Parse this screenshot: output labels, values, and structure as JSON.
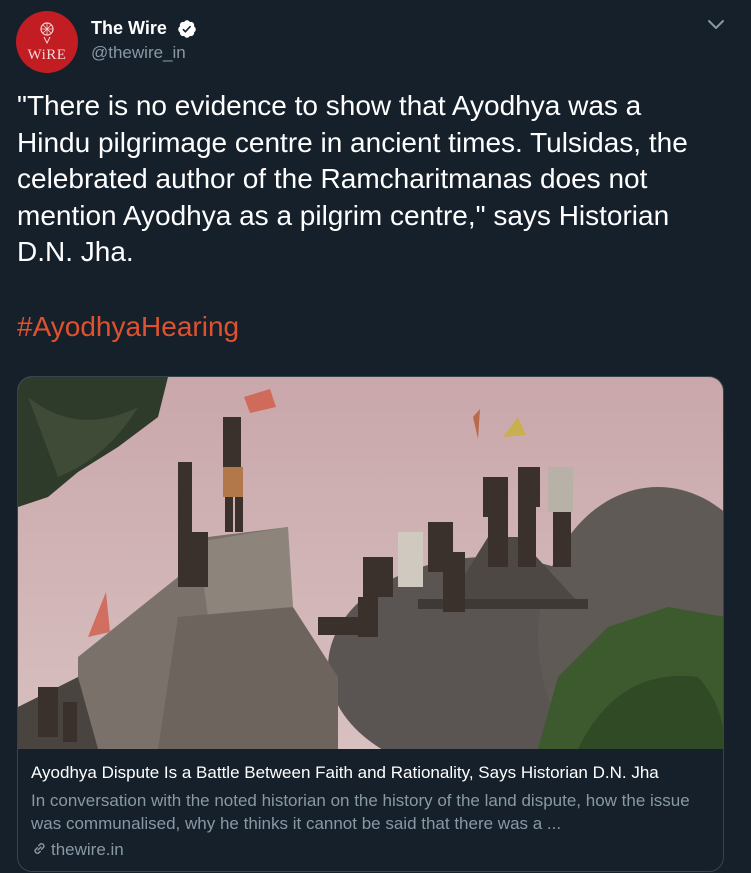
{
  "author": {
    "name": "The Wire",
    "handle": "@thewire_in",
    "avatar_text": "WiRE",
    "verified": true
  },
  "icons": {
    "verified": "verified-badge-icon",
    "menu": "chevron-down-icon",
    "link": "link-icon"
  },
  "tweet": {
    "text": "\"There is no evidence to show that Ayodhya was a\nHindu pilgrimage centre in ancient times. Tulsidas, the\ncelebrated author of the Ramcharitmanas does not\nmention Ayodhya as a pilgrim centre,\" says Historian\nD.N. Jha.",
    "hashtag": "#AyodhyaHearing"
  },
  "card": {
    "title": "Ayodhya Dispute Is a Battle Between Faith and Rationality, Says Historian D.N. Jha",
    "description": "In conversation with the noted historian on the history of the land dispute, how the issue was communalised, why he thinks it cannot be said that there was a ...",
    "domain": "thewire.in"
  },
  "colors": {
    "background": "#15202b",
    "secondary_text": "#8899a6",
    "hashtag": "#e0522d",
    "brand": "#c11d22"
  }
}
